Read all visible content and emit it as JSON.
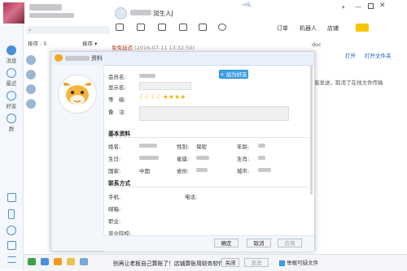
{
  "app": {
    "status_suffix": "润生人J",
    "tabs_right": [
      "订单",
      "机器人",
      "店铺"
    ]
  },
  "leftnav": [
    {
      "label": "消息",
      "icon": "chat-icon"
    },
    {
      "label": "最近",
      "icon": "clock-icon"
    },
    {
      "label": "好友",
      "icon": "friend-icon"
    },
    {
      "label": "群",
      "icon": "group-icon"
    }
  ],
  "list": {
    "sort_label": "排序 : 5",
    "sort_option": "排序",
    "timestamp_line": "(2016-07-11 13:32:50)",
    "timestamp_prefix": "免免延迟"
  },
  "chat": {
    "open_label": "打开",
    "open_folder_label": "打开文件夹",
    "notice_text": "能发送，取消了在线文件传输",
    "doc_suffix": "doc"
  },
  "dialog": {
    "title_suffix": "资料",
    "add_friend": "+ 加为好友",
    "fields": {
      "member_name": "会员名:",
      "display_name": "显示名:",
      "level": "等　级:",
      "remark": "备　注:"
    },
    "level_moons": 4,
    "level_stars": 4,
    "basic_section": "基本资料",
    "basic": {
      "name": "姓名:",
      "gender": "性别:",
      "gender_value": "保密",
      "age": "年龄:",
      "birthday": "生日:",
      "zodiac": "星座:",
      "chinese_zodiac": "生肖:",
      "country": "国家:",
      "country_value": "中国",
      "province": "省份:",
      "city": "城市:"
    },
    "contact_section": "联系方式",
    "contact": {
      "mobile": "手机:",
      "phone": "电话:",
      "email": "邮箱:",
      "job": "职业:",
      "school": "毕业院校:"
    },
    "buttons": {
      "ok": "确定",
      "cancel": "取消",
      "apply": "应用"
    }
  },
  "bottom": {
    "marquee": "别再让老板自己算账了！店铺算账用财务软件",
    "close_btn": "关闭",
    "send_btn": "发送",
    "checkbox_label": "举报可疑文件"
  },
  "colors": {
    "accent": "#3fa0e8",
    "nav_icon": "#4a8fd8",
    "star": "#f2b400"
  }
}
